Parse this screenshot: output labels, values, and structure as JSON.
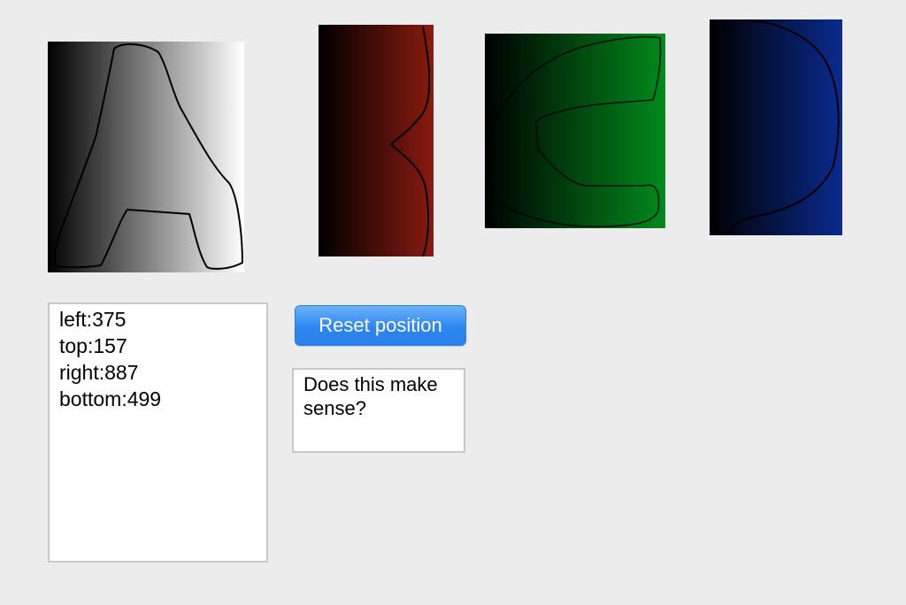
{
  "tiles": [
    {
      "letter": "A",
      "gradient": [
        "#000000",
        "#ffffff"
      ]
    },
    {
      "letter": "B",
      "gradient": [
        "#000000",
        "#8a1a10"
      ]
    },
    {
      "letter": "C",
      "gradient": [
        "#000000",
        "#028a1c"
      ]
    },
    {
      "letter": "D",
      "gradient": [
        "#000000",
        "#0a2a8e"
      ]
    }
  ],
  "coords": {
    "left": "left:375",
    "top": "top:157",
    "right": "right:887",
    "bottom": "bottom:499"
  },
  "reset_button": {
    "label": "Reset position"
  },
  "question_box": {
    "text": "Does this make\nsense?"
  }
}
